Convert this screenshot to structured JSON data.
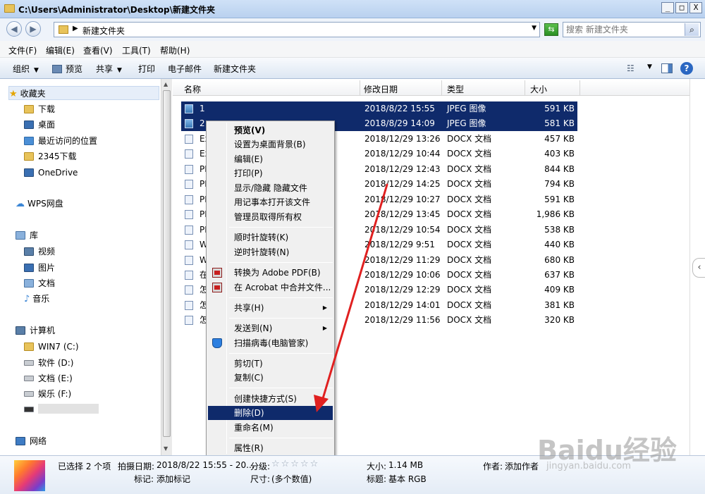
{
  "window": {
    "title": "C:\\Users\\Administrator\\Desktop\\新建文件夹",
    "controls": [
      "_",
      "□",
      "X"
    ]
  },
  "address": {
    "path": "新建文件夹",
    "search_placeholder": "搜索 新建文件夹"
  },
  "menu": [
    "文件(F)",
    "编辑(E)",
    "查看(V)",
    "工具(T)",
    "帮助(H)"
  ],
  "toolbar": {
    "organize": "组织",
    "preview": "预览",
    "share": "共享",
    "print": "打印",
    "email": "电子邮件",
    "new_folder": "新建文件夹"
  },
  "nav": {
    "favorites": "收藏夹",
    "fav_items": [
      "下载",
      "桌面",
      "最近访问的位置",
      "2345下载",
      "OneDrive"
    ],
    "wps": "WPS网盘",
    "library": "库",
    "lib_items": [
      "视频",
      "图片",
      "文档",
      "音乐"
    ],
    "computer": "计算机",
    "drives": [
      "WIN7 (C:)",
      "软件 (D:)",
      "文档 (E:)",
      "娱乐 (F:)"
    ],
    "network": "网络"
  },
  "columns": [
    "名称",
    "修改日期",
    "类型",
    "大小"
  ],
  "files": [
    {
      "name": "1",
      "date": "2018/8/22 15:55",
      "type": "JPEG 图像",
      "size": "591 KB"
    },
    {
      "name": "2",
      "date": "2018/8/29 14:09",
      "type": "JPEG 图像",
      "size": "581 KB"
    },
    {
      "name": "Ex",
      "date": "2018/12/29 13:26",
      "type": "DOCX 文档",
      "size": "457 KB"
    },
    {
      "name": "Ex",
      "date": "2018/12/29 10:44",
      "type": "DOCX 文档",
      "size": "403 KB"
    },
    {
      "name": "PF",
      "date": "2018/12/29 12:43",
      "type": "DOCX 文档",
      "size": "844 KB"
    },
    {
      "name": "PF",
      "date": "2018/12/29 14:25",
      "type": "DOCX 文档",
      "size": "794 KB"
    },
    {
      "name": "PF",
      "date": "2018/12/29 10:27",
      "type": "DOCX 文档",
      "size": "591 KB"
    },
    {
      "name": "PF",
      "date": "2018/12/29 13:45",
      "type": "DOCX 文档",
      "size": "1,986 KB"
    },
    {
      "name": "PF",
      "date": "2018/12/29 10:54",
      "type": "DOCX 文档",
      "size": "538 KB"
    },
    {
      "name": "W",
      "date": "2018/12/29 9:51",
      "type": "DOCX 文档",
      "size": "440 KB"
    },
    {
      "name": "W",
      "date": "2018/12/29 11:29",
      "type": "DOCX 文档",
      "size": "680 KB"
    },
    {
      "name": "在",
      "date": "2018/12/29 10:06",
      "type": "DOCX 文档",
      "size": "637 KB"
    },
    {
      "name": "怎",
      "date": "2018/12/29 12:29",
      "type": "DOCX 文档",
      "size": "409 KB"
    },
    {
      "name": "怎",
      "date": "2018/12/29 14:01",
      "type": "DOCX 文档",
      "size": "381 KB"
    },
    {
      "name": "怎",
      "date": "2018/12/29 11:56",
      "type": "DOCX 文档",
      "size": "320 KB"
    }
  ],
  "context_menu": {
    "preview": "预览(V)",
    "set_wallpaper": "设置为桌面背景(B)",
    "edit": "编辑(E)",
    "print": "打印(P)",
    "toggle_hidden": "显示/隐藏 隐藏文件",
    "open_notepad": "用记事本打开该文件",
    "take_ownership": "管理员取得所有权",
    "rotate_cw": "顺时针旋转(K)",
    "rotate_ccw": "逆时针旋转(N)",
    "to_pdf": "转换为 Adobe PDF(B)",
    "acrobat_merge": "在 Acrobat 中合并文件...",
    "share": "共享(H)",
    "send_to": "发送到(N)",
    "scan": "扫描病毒(电脑管家)",
    "cut": "剪切(T)",
    "copy": "复制(C)",
    "shortcut": "创建快捷方式(S)",
    "delete": "删除(D)",
    "rename": "重命名(M)",
    "properties": "属性(R)"
  },
  "details": {
    "selected": "已选择 2 个项",
    "date_label": "拍摄日期:",
    "date_value": "2018/8/22 15:55 - 20...",
    "rating_label": "分级:",
    "stars": "☆☆☆☆☆",
    "tag_label": "标记:",
    "tag_value": "添加标记",
    "size_label": "大小:",
    "size_value": "1.14 MB",
    "dim_label": "尺寸:",
    "dim_value": "(多个数值)",
    "title_label": "标题:",
    "title_value": "基本 RGB",
    "author_label": "作者:",
    "author_value": "添加作者"
  },
  "watermark": {
    "logo": "Baidu经验",
    "url": "jingyan.baidu.com"
  },
  "colors": {
    "selection": "#0f2a6b",
    "arrow": "#e02020"
  }
}
